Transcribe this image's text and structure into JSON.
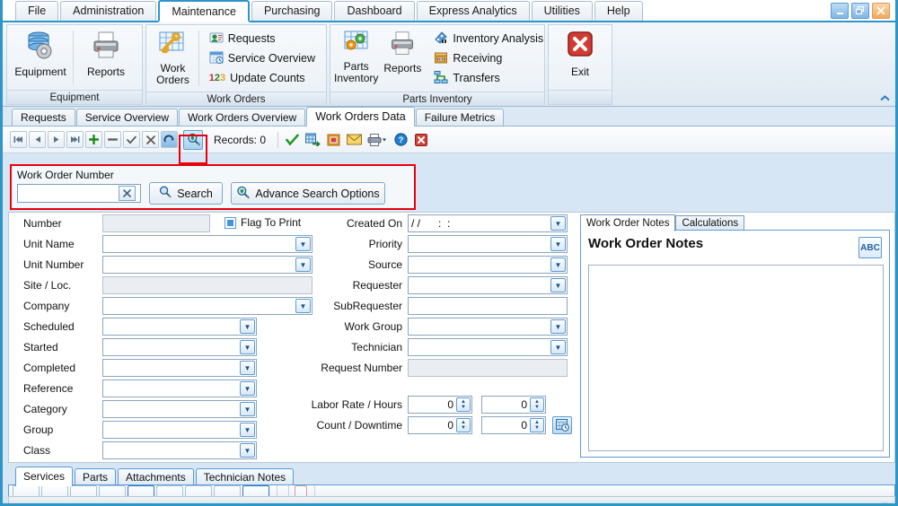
{
  "window": {
    "minimize_label": "–",
    "restore_label": "❐",
    "close_label": "✕"
  },
  "ribbon_tabs": [
    {
      "label": "File",
      "active": false
    },
    {
      "label": "Administration",
      "active": false
    },
    {
      "label": "Maintenance",
      "active": true
    },
    {
      "label": "Purchasing",
      "active": false
    },
    {
      "label": "Dashboard",
      "active": false
    },
    {
      "label": "Express Analytics",
      "active": false
    },
    {
      "label": "Utilities",
      "active": false
    },
    {
      "label": "Help",
      "active": false
    }
  ],
  "ribbon": {
    "collapse_icon": "chevron-up-icon",
    "groups": [
      {
        "title": "Equipment",
        "big_buttons": [
          {
            "label": "Equipment",
            "icon": "database-gear-icon"
          },
          {
            "label": "Reports",
            "icon": "printer-icon"
          }
        ],
        "small_buttons": []
      },
      {
        "title": "Work Orders",
        "big_buttons": [
          {
            "label": "Work Orders",
            "icon": "grid-wrench-icon"
          }
        ],
        "small_buttons": [
          {
            "label": "Requests",
            "icon": "person-card-icon"
          },
          {
            "label": "Service Overview",
            "icon": "calendar-clock-icon"
          },
          {
            "label": "Update Counts",
            "icon": "numbers-123-icon"
          }
        ]
      },
      {
        "title": "Parts Inventory",
        "big_buttons": [
          {
            "label": "Parts Inventory",
            "icon": "grid-gears-icon"
          },
          {
            "label": "Reports",
            "icon": "printer-icon"
          }
        ],
        "small_buttons": [
          {
            "label": "Inventory Analysis",
            "icon": "analysis-icon"
          },
          {
            "label": "Receiving",
            "icon": "box-icon"
          },
          {
            "label": "Transfers",
            "icon": "transfer-icon"
          }
        ]
      },
      {
        "title": "",
        "big_buttons": [
          {
            "label": "Exit",
            "icon": "exit-red-x-icon"
          }
        ],
        "small_buttons": []
      }
    ]
  },
  "document_tabs": [
    {
      "label": "Requests",
      "active": false
    },
    {
      "label": "Service Overview",
      "active": false
    },
    {
      "label": "Work Orders Overview",
      "active": false
    },
    {
      "label": "Work Orders Data",
      "active": true
    },
    {
      "label": "Failure Metrics",
      "active": false
    }
  ],
  "navbar": {
    "records_label": "Records: 0",
    "buttons": [
      {
        "name": "first-record-button",
        "glyph": "⏮"
      },
      {
        "name": "previous-record-button",
        "glyph": "◀"
      },
      {
        "name": "next-record-button",
        "glyph": "▶"
      },
      {
        "name": "last-record-button",
        "glyph": "⏭"
      },
      {
        "name": "add-record-button",
        "glyph": "+"
      },
      {
        "name": "delete-record-button",
        "glyph": "−"
      },
      {
        "name": "post-edit-button",
        "glyph": "✓"
      },
      {
        "name": "cancel-edit-button",
        "glyph": "✕"
      },
      {
        "name": "refresh-button",
        "glyph": "↻"
      },
      {
        "name": "search-toggle-button",
        "glyph": "⚲"
      }
    ],
    "tool_icons": [
      {
        "name": "apply-filter-icon",
        "glyph": "✔"
      },
      {
        "name": "export-grid-icon",
        "glyph": "▦"
      },
      {
        "name": "export-excel-icon",
        "glyph": "▣"
      },
      {
        "name": "email-icon",
        "glyph": "✉"
      },
      {
        "name": "print-icon",
        "glyph": "⎙"
      },
      {
        "name": "help-icon",
        "glyph": "?"
      },
      {
        "name": "close-icon",
        "glyph": "✕"
      }
    ]
  },
  "search_panel": {
    "field_label": "Work Order Number",
    "input_value": "",
    "input_placeholder": "",
    "clear_label": "✕",
    "search_button": "Search",
    "advance_button": "Advance Search Options",
    "highlight_color": "#e8000d"
  },
  "form": {
    "left_fields": [
      {
        "label": "Number",
        "value": "",
        "type": "text",
        "disabled": true
      },
      {
        "label": "Unit Name",
        "value": "",
        "type": "combo",
        "disabled": false
      },
      {
        "label": "Unit Number",
        "value": "",
        "type": "combo",
        "disabled": false
      },
      {
        "label": "Site / Loc.",
        "value": "",
        "type": "text",
        "disabled": true
      },
      {
        "label": "Company",
        "value": "",
        "type": "combo",
        "disabled": false
      },
      {
        "label": "Scheduled",
        "value": "",
        "type": "combo",
        "disabled": false
      },
      {
        "label": "Started",
        "value": "",
        "type": "combo",
        "disabled": false
      },
      {
        "label": "Completed",
        "value": "",
        "type": "combo",
        "disabled": false
      },
      {
        "label": "Reference",
        "value": "",
        "type": "combo",
        "disabled": false
      },
      {
        "label": "Category",
        "value": "",
        "type": "combo",
        "disabled": false
      },
      {
        "label": "Group",
        "value": "",
        "type": "combo",
        "disabled": false
      },
      {
        "label": "Class",
        "value": "",
        "type": "combo",
        "disabled": false
      }
    ],
    "flag_to_print": {
      "label": "Flag To Print",
      "checked": true
    },
    "middle_fields": [
      {
        "label": "Created On",
        "value": "/ /      :  :",
        "type": "combo",
        "disabled": false
      },
      {
        "label": "Priority",
        "value": "",
        "type": "combo",
        "disabled": false
      },
      {
        "label": "Source",
        "value": "",
        "type": "combo",
        "disabled": false
      },
      {
        "label": "Requester",
        "value": "",
        "type": "combo",
        "disabled": false
      },
      {
        "label": "SubRequester",
        "value": "",
        "type": "text",
        "disabled": false
      },
      {
        "label": "Work Group",
        "value": "",
        "type": "combo",
        "disabled": false
      },
      {
        "label": "Technician",
        "value": "",
        "type": "combo",
        "disabled": false
      },
      {
        "label": "Request Number",
        "value": "",
        "type": "text",
        "disabled": true
      }
    ],
    "numeric_rows": [
      {
        "label": "Labor Rate / Hours",
        "value1": "0",
        "value2": "0"
      },
      {
        "label": "Count / Downtime",
        "value1": "0",
        "value2": "0"
      }
    ],
    "downtime_calc_icon": "downtime-calculator-icon"
  },
  "notes_panel": {
    "tabs": [
      {
        "label": "Work Order Notes",
        "active": true
      },
      {
        "label": "Calculations",
        "active": false
      }
    ],
    "heading": "Work Order Notes",
    "spellcheck_label": "ABC",
    "text_value": "",
    "text_placeholder": ""
  },
  "bottom_tabs": [
    {
      "label": "Services",
      "active": true
    },
    {
      "label": "Parts",
      "active": false
    },
    {
      "label": "Attachments",
      "active": false
    },
    {
      "label": "Technician Notes",
      "active": false
    }
  ]
}
